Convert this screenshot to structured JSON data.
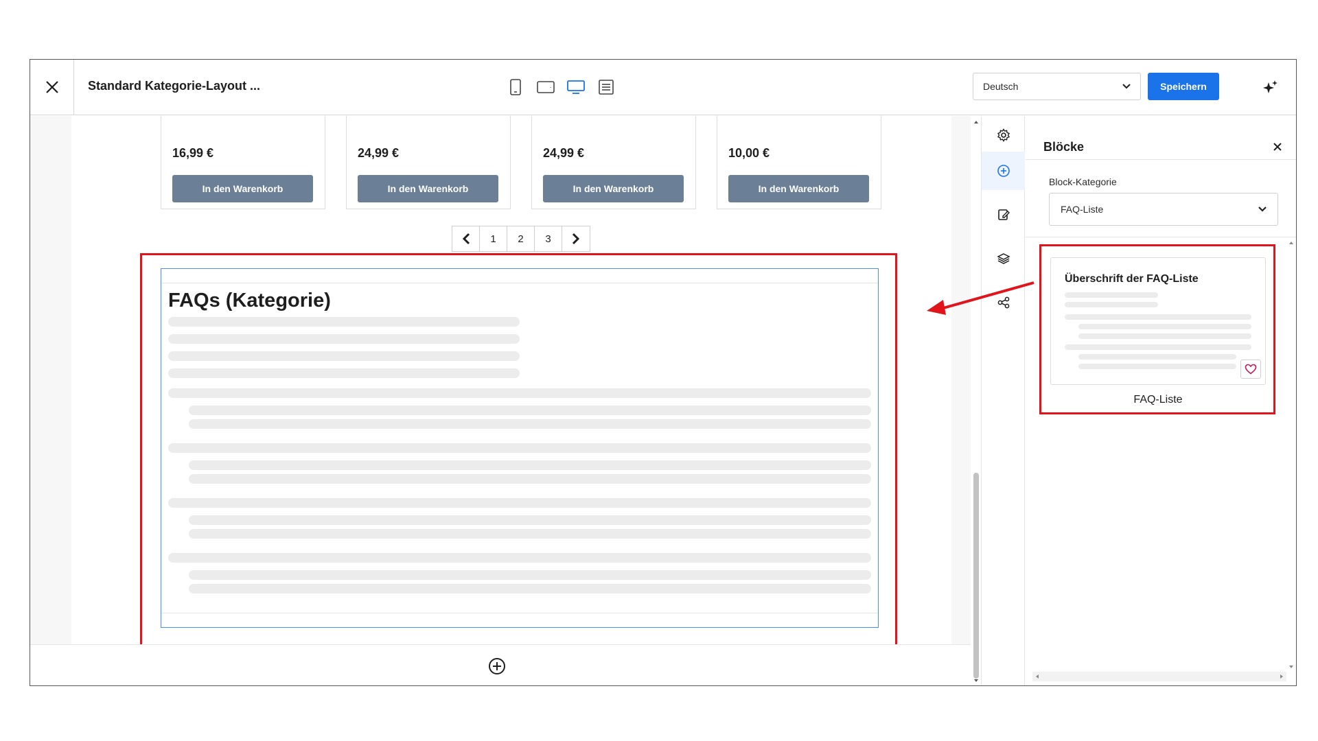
{
  "header": {
    "title": "Standard Kategorie-Layout ...",
    "language": "Deutsch",
    "save_label": "Speichern"
  },
  "products": [
    {
      "price": "16,99 €",
      "button": "In den Warenkorb"
    },
    {
      "price": "24,99 €",
      "button": "In den Warenkorb"
    },
    {
      "price": "24,99 €",
      "button": "In den Warenkorb"
    },
    {
      "price": "10,00 €",
      "button": "In den Warenkorb"
    }
  ],
  "pagination": {
    "pages": [
      "1",
      "2",
      "3"
    ]
  },
  "faq": {
    "title": "FAQs (Kategorie)"
  },
  "panel": {
    "title": "Blöcke",
    "category_label": "Block-Kategorie",
    "category_value": "FAQ-Liste",
    "block_card_title": "Überschrift der FAQ-Liste",
    "block_card_label": "FAQ-Liste"
  },
  "colors": {
    "accent": "#1a73e8",
    "cart_button": "#6b7f97",
    "highlight": "#e2141b",
    "favorite": "#c2185b"
  }
}
